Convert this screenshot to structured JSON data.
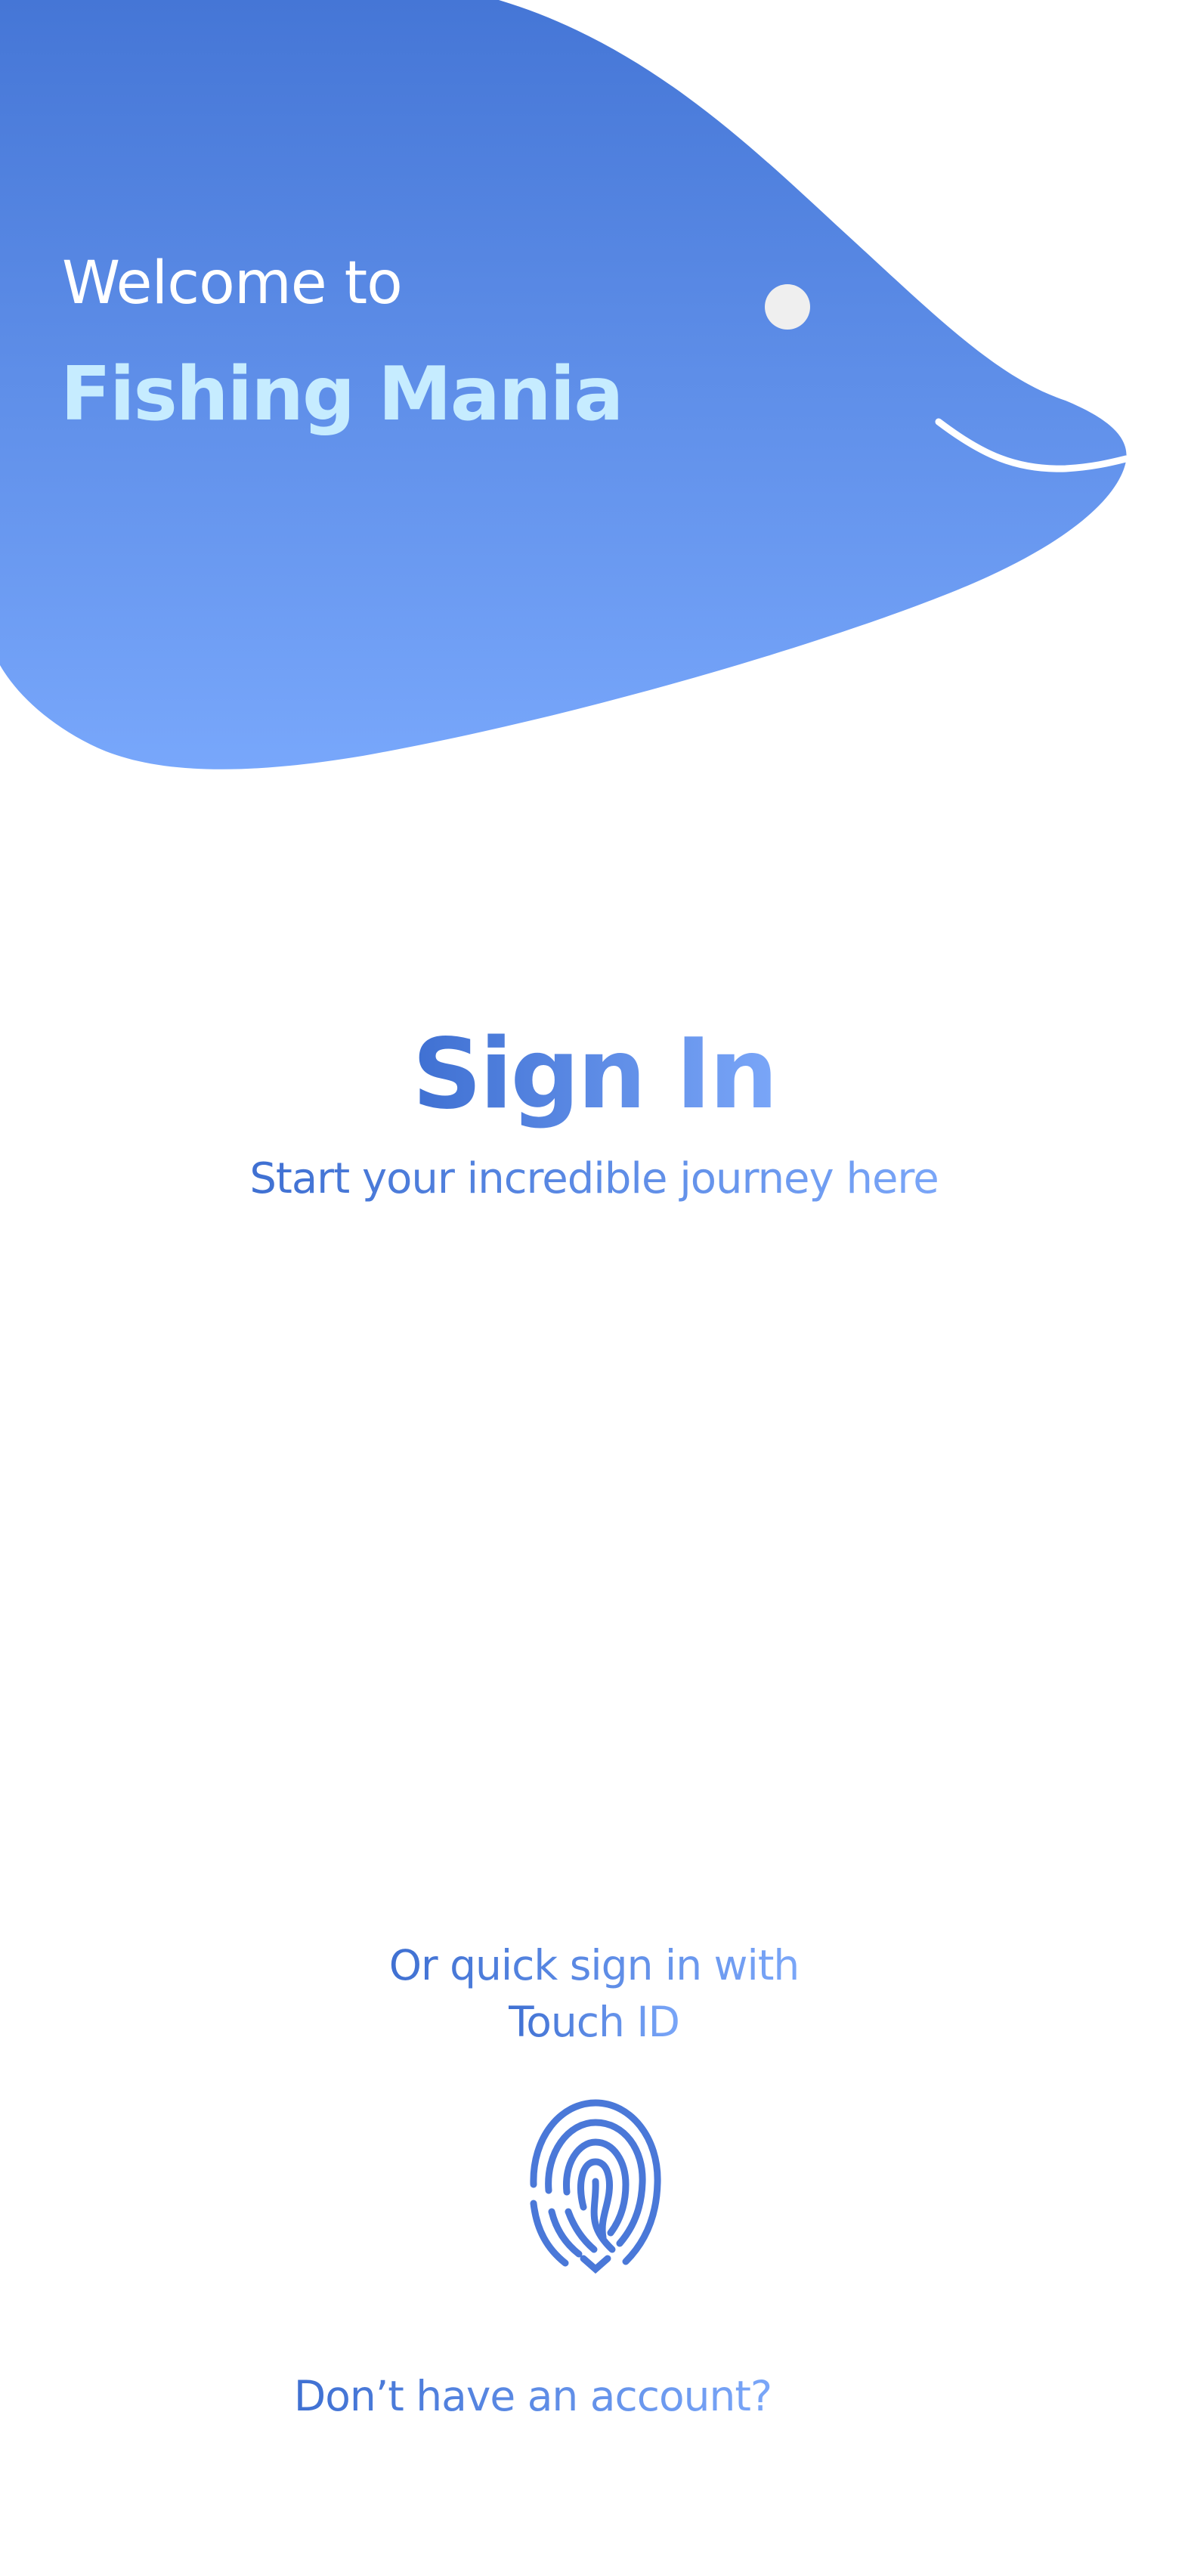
{
  "header": {
    "welcome_text": "Welcome to",
    "app_name": "Fishing Mania"
  },
  "signin": {
    "title": "Sign In",
    "subtitle": "Start your incredible journey here"
  },
  "touch_id": {
    "line1": "Or quick sign in with",
    "line2": "Touch ID"
  },
  "footer": {
    "signup_link": "Don’t have an account?"
  },
  "colors": {
    "fish_top": "#4576d6",
    "fish_bottom": "#78a7fb",
    "accent_dark": "#3f70d2",
    "accent_light": "#7aa6f8",
    "app_name": "#c6ecff",
    "fingerprint": "#4a78d8"
  },
  "icons": {
    "fingerprint": "fingerprint-icon"
  }
}
